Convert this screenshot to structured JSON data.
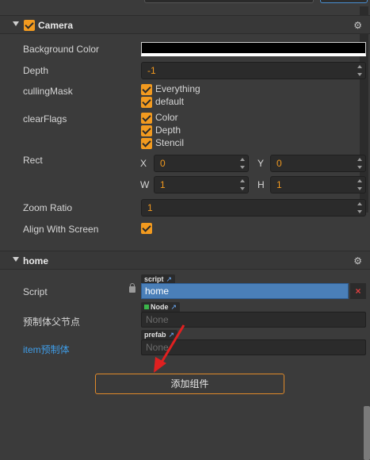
{
  "camera": {
    "header": "Camera",
    "enabled": true,
    "background_color_label": "Background Color",
    "background_color": "#000000",
    "depth_label": "Depth",
    "depth_value": "-1",
    "culling_mask_label": "cullingMask",
    "culling_mask_options": [
      "Everything",
      "default"
    ],
    "clear_flags_label": "clearFlags",
    "clear_flags_options": [
      "Color",
      "Depth",
      "Stencil"
    ],
    "rect_label": "Rect",
    "rect": {
      "x_label": "X",
      "x": "0",
      "y_label": "Y",
      "y": "0",
      "w_label": "W",
      "w": "1",
      "h_label": "H",
      "h": "1"
    },
    "zoom_ratio_label": "Zoom Ratio",
    "zoom_ratio": "1",
    "align_with_screen_label": "Align With Screen",
    "align_with_screen": true
  },
  "home": {
    "header": "home",
    "script_label": "Script",
    "script_tag": "script",
    "script_value": "home",
    "script_remove": "×",
    "parent_node_label": "预制体父节点",
    "parent_node_tag": "Node",
    "parent_node_value": "None",
    "item_prefab_label": "item预制体",
    "item_prefab_tag": "prefab",
    "item_prefab_value": "None"
  },
  "add_component_label": "添加组件",
  "colors": {
    "accent_orange": "#f29a1f",
    "link_blue": "#3f9de8",
    "panel_bg": "#3b3b3b",
    "annotation_red": "#e02020"
  },
  "icons": {
    "gear": "gear-icon",
    "lock": "lock-icon",
    "external_link": "external-link-icon"
  }
}
